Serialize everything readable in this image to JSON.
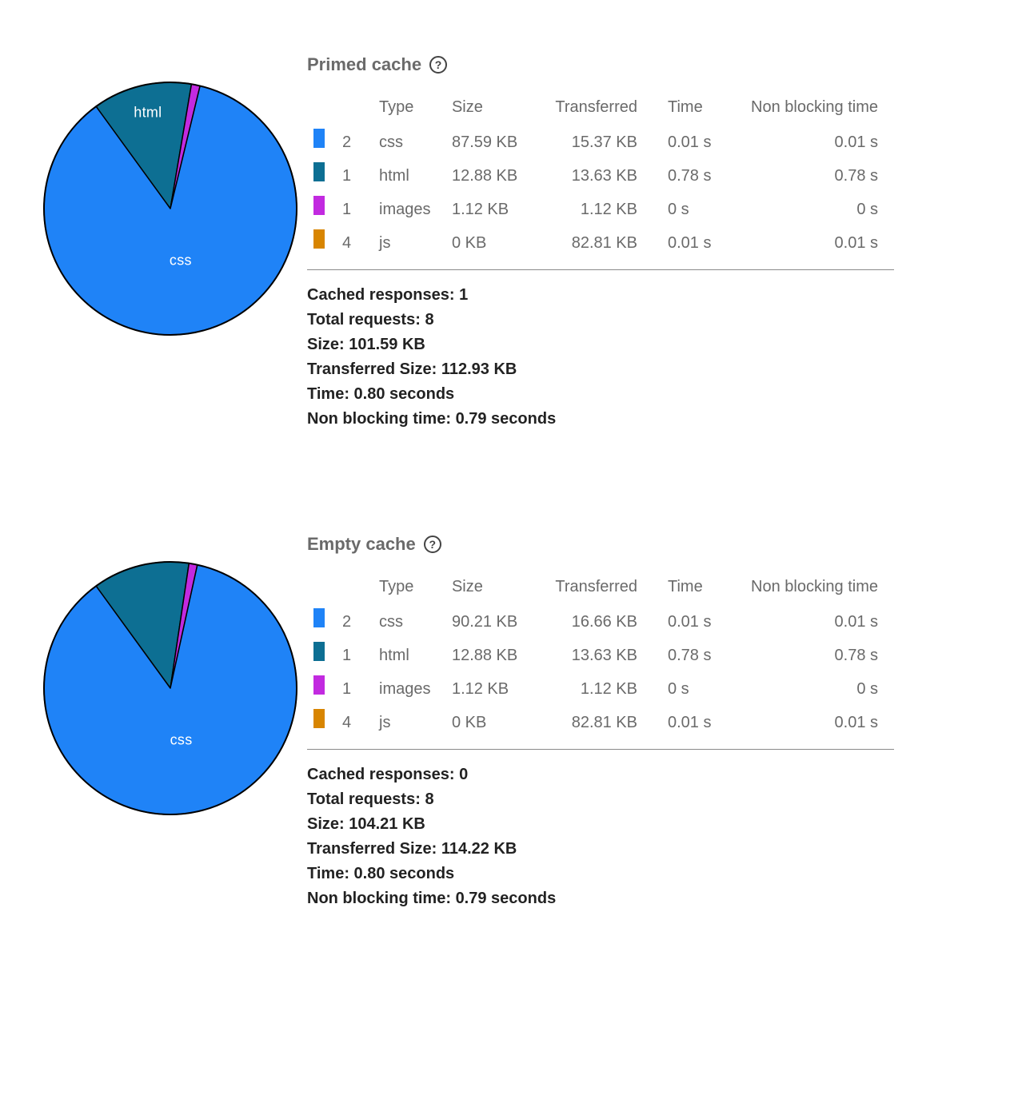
{
  "colors": {
    "css": "#1f83f7",
    "html": "#0d6f93",
    "images": "#c22ae0",
    "js": "#d88500"
  },
  "tableHeaders": {
    "type": "Type",
    "size": "Size",
    "transferred": "Transferred",
    "time": "Time",
    "nonblock": "Non blocking time"
  },
  "summaryLabels": {
    "cached": "Cached responses:",
    "requests": "Total requests:",
    "size": "Size:",
    "transferred": "Transferred Size:",
    "time": "Time:",
    "nonblock": "Non blocking time:"
  },
  "sections": [
    {
      "title": "Primed cache",
      "rows": [
        {
          "color": "css",
          "count": "2",
          "type": "css",
          "size": "87.59 KB",
          "transferred": "15.37 KB",
          "time": "0.01 s",
          "nonblock": "0.01 s"
        },
        {
          "color": "html",
          "count": "1",
          "type": "html",
          "size": "12.88 KB",
          "transferred": "13.63 KB",
          "time": "0.78 s",
          "nonblock": "0.78 s"
        },
        {
          "color": "images",
          "count": "1",
          "type": "images",
          "size": "1.12 KB",
          "transferred": "1.12 KB",
          "time": "0 s",
          "nonblock": "0 s"
        },
        {
          "color": "js",
          "count": "4",
          "type": "js",
          "size": "0 KB",
          "transferred": "82.81 KB",
          "time": "0.01 s",
          "nonblock": "0.01 s"
        }
      ],
      "summary": {
        "cached": "1",
        "requests": "8",
        "size": "101.59 KB",
        "transferred": "112.93 KB",
        "time": "0.80 seconds",
        "nonblock": "0.79 seconds"
      },
      "pieLabels": {
        "css": "css",
        "html": "html"
      }
    },
    {
      "title": "Empty cache",
      "rows": [
        {
          "color": "css",
          "count": "2",
          "type": "css",
          "size": "90.21 KB",
          "transferred": "16.66 KB",
          "time": "0.01 s",
          "nonblock": "0.01 s"
        },
        {
          "color": "html",
          "count": "1",
          "type": "html",
          "size": "12.88 KB",
          "transferred": "13.63 KB",
          "time": "0.78 s",
          "nonblock": "0.78 s"
        },
        {
          "color": "images",
          "count": "1",
          "type": "images",
          "size": "1.12 KB",
          "transferred": "1.12 KB",
          "time": "0 s",
          "nonblock": "0 s"
        },
        {
          "color": "js",
          "count": "4",
          "type": "js",
          "size": "0 KB",
          "transferred": "82.81 KB",
          "time": "0.01 s",
          "nonblock": "0.01 s"
        }
      ],
      "summary": {
        "cached": "0",
        "requests": "8",
        "size": "104.21 KB",
        "transferred": "114.22 KB",
        "time": "0.80 seconds",
        "nonblock": "0.79 seconds"
      },
      "pieLabels": {
        "css": "css"
      }
    }
  ],
  "chart_data": [
    {
      "type": "pie",
      "title": "Primed cache",
      "categories": [
        "css",
        "html",
        "images",
        "js"
      ],
      "values": [
        87.59,
        12.88,
        1.12,
        0
      ],
      "unit": "KB",
      "colors": {
        "css": "#1f83f7",
        "html": "#0d6f93",
        "images": "#c22ae0",
        "js": "#d88500"
      }
    },
    {
      "type": "pie",
      "title": "Empty cache",
      "categories": [
        "css",
        "html",
        "images",
        "js"
      ],
      "values": [
        90.21,
        12.88,
        1.12,
        0
      ],
      "unit": "KB",
      "colors": {
        "css": "#1f83f7",
        "html": "#0d6f93",
        "images": "#c22ae0",
        "js": "#d88500"
      }
    }
  ]
}
